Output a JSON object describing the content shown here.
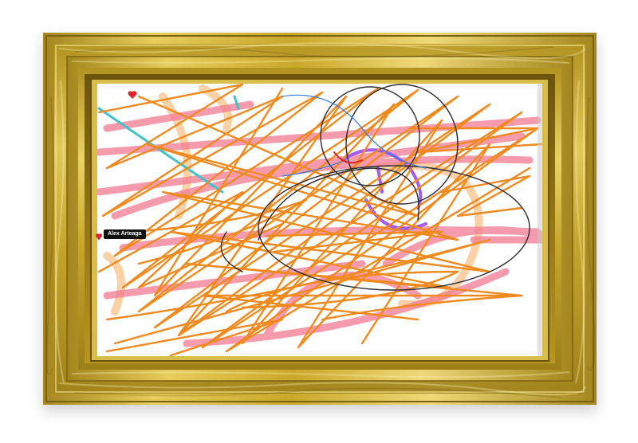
{
  "canvas": {
    "background": "#ffffff",
    "frame_style": "ornate gold picture frame",
    "colors": {
      "gold_light": "#f0d86a",
      "gold_mid": "#c9a72a",
      "gold_dark": "#8a6d12",
      "orange_stroke": "#f08a1e",
      "pink_stroke": "#f47a92",
      "peach_stroke": "#f9c38a",
      "cyan_stroke": "#3fc3c9",
      "purple_stroke": "#a35cf0",
      "dark_stroke": "#2a2a35",
      "red_marker": "#e0232b"
    }
  },
  "collaborator_cursor": {
    "name": "Alex Arteaga",
    "icon": "heart-icon",
    "color": "#e0232b"
  },
  "marker": {
    "icon": "heart-icon",
    "color": "#e0232b"
  }
}
